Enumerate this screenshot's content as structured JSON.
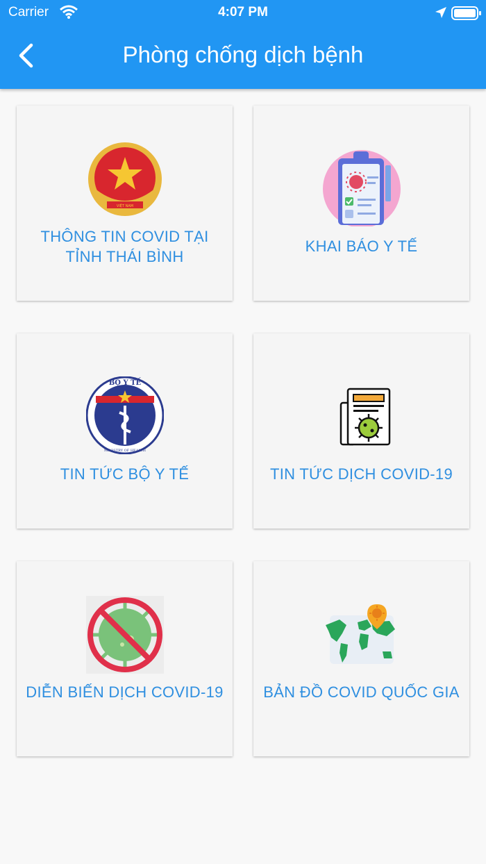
{
  "status_bar": {
    "carrier": "Carrier",
    "time": "4:07 PM"
  },
  "header": {
    "title": "Phòng chống dịch bệnh",
    "back_icon": "chevron-left-icon"
  },
  "colors": {
    "app_bar": "#2196f3",
    "label": "#2f8fe0",
    "card_bg": "#f5f5f5",
    "page_bg": "#f8f8f8"
  },
  "menu": [
    {
      "label": "THÔNG TIN COVID TẠI TỈNH THÁI BÌNH",
      "icon": "vietnam-emblem-icon"
    },
    {
      "label": "KHAI BÁO Y TẾ",
      "icon": "medical-clipboard-icon"
    },
    {
      "label": "TIN TỨC BỘ Y TẾ",
      "icon": "ministry-of-health-logo-icon"
    },
    {
      "label": "TIN TỨC DỊCH COVID-19",
      "icon": "virus-newspaper-icon"
    },
    {
      "label": "DIỄN BIẾN DỊCH COVID-19",
      "icon": "no-virus-icon"
    },
    {
      "label": "BẢN ĐỒ COVID QUỐC GIA",
      "icon": "world-map-pin-icon"
    }
  ],
  "logos": {
    "emblem_text": "VIỆT NAM",
    "moh_top": "BỘ Y TẾ",
    "moh_bottom": "MINISTRY OF HEALTH"
  }
}
